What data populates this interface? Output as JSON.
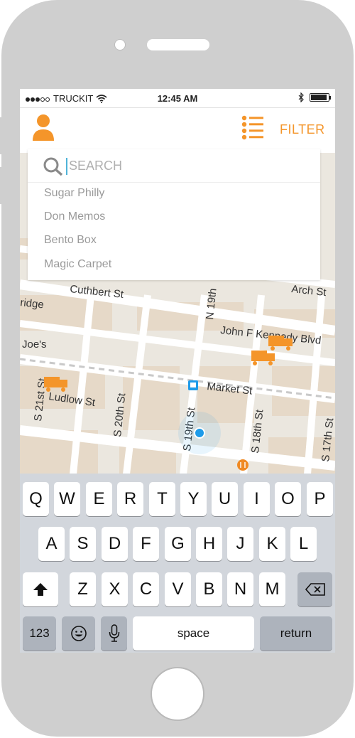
{
  "status_bar": {
    "carrier": "TRUCKIT",
    "time": "12:45 AM"
  },
  "header": {
    "filter_label": "FILTER"
  },
  "search": {
    "placeholder": "SEARCH",
    "suggestions": [
      "Sugar Philly",
      "Don Memos",
      "Bento Box",
      "Magic Carpet"
    ]
  },
  "map": {
    "street_labels": [
      "Cuthbert St",
      "Arch St",
      "N 19th",
      "ridge",
      "John F Kennedy Blvd",
      "Joe's",
      "Market St",
      "Ludlow St",
      "S 21st St",
      "S 20th St",
      "S 19th St",
      "S 18th St",
      "S 17th St"
    ]
  },
  "keyboard": {
    "row1": [
      "Q",
      "W",
      "E",
      "R",
      "T",
      "Y",
      "U",
      "I",
      "O",
      "P"
    ],
    "row2": [
      "A",
      "S",
      "D",
      "F",
      "G",
      "H",
      "J",
      "K",
      "L"
    ],
    "row3": [
      "Z",
      "X",
      "C",
      "V",
      "B",
      "N",
      "M"
    ],
    "numbers_label": "123",
    "space_label": "space",
    "return_label": "return"
  },
  "colors": {
    "accent": "#f4952a",
    "location_dot": "#1e9be9",
    "cursor": "#4fb3d9"
  },
  "icons": [
    "user-icon",
    "list-menu-icon",
    "search-icon",
    "truck-icon",
    "location-dot-icon",
    "restaurant-pin-icon",
    "metro-icon",
    "shift-icon",
    "backspace-icon",
    "emoji-icon",
    "microphone-icon"
  ]
}
